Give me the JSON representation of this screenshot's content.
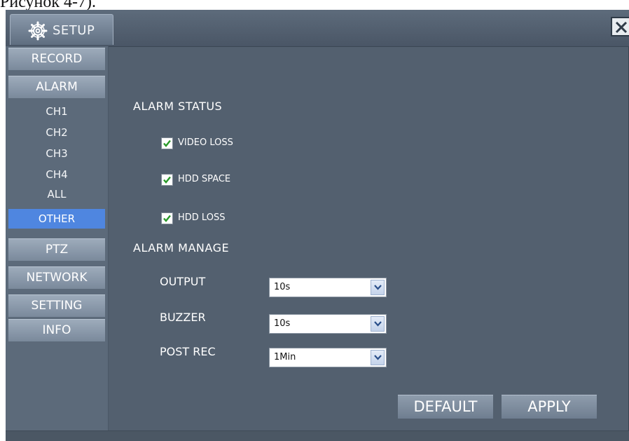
{
  "page_caption_fragment": "Рисунок 4-7).",
  "window": {
    "title": "SETUP",
    "title_icon": "gear-icon",
    "close_icon": "close-icon"
  },
  "sidebar": {
    "items": [
      {
        "label": "RECORD"
      },
      {
        "label": "ALARM"
      },
      {
        "label": "PTZ"
      },
      {
        "label": "NETWORK"
      },
      {
        "label": "SETTING"
      },
      {
        "label": "INFO"
      }
    ],
    "alarm_subitems": [
      {
        "label": "CH1"
      },
      {
        "label": "CH2"
      },
      {
        "label": "CH3"
      },
      {
        "label": "CH4"
      },
      {
        "label": "ALL"
      },
      {
        "label": "OTHER",
        "selected": true
      }
    ]
  },
  "alarm_status": {
    "heading": "ALARM STATUS",
    "checks": [
      {
        "label": "VIDEO LOSS",
        "checked": true
      },
      {
        "label": "HDD SPACE",
        "checked": true
      },
      {
        "label": "HDD LOSS",
        "checked": true
      }
    ]
  },
  "alarm_manage": {
    "heading": "ALARM MANAGE",
    "fields": [
      {
        "label": "OUTPUT",
        "value": "10s"
      },
      {
        "label": "BUZZER",
        "value": "10s"
      },
      {
        "label": "POST REC",
        "value": "1Min"
      }
    ]
  },
  "buttons": {
    "default_label": "DEFAULT",
    "apply_label": "APPLY"
  },
  "colors": {
    "window_bg": "#53606f",
    "selected_item": "#4f86e0",
    "checkbox_check": "#2a9a2a"
  }
}
